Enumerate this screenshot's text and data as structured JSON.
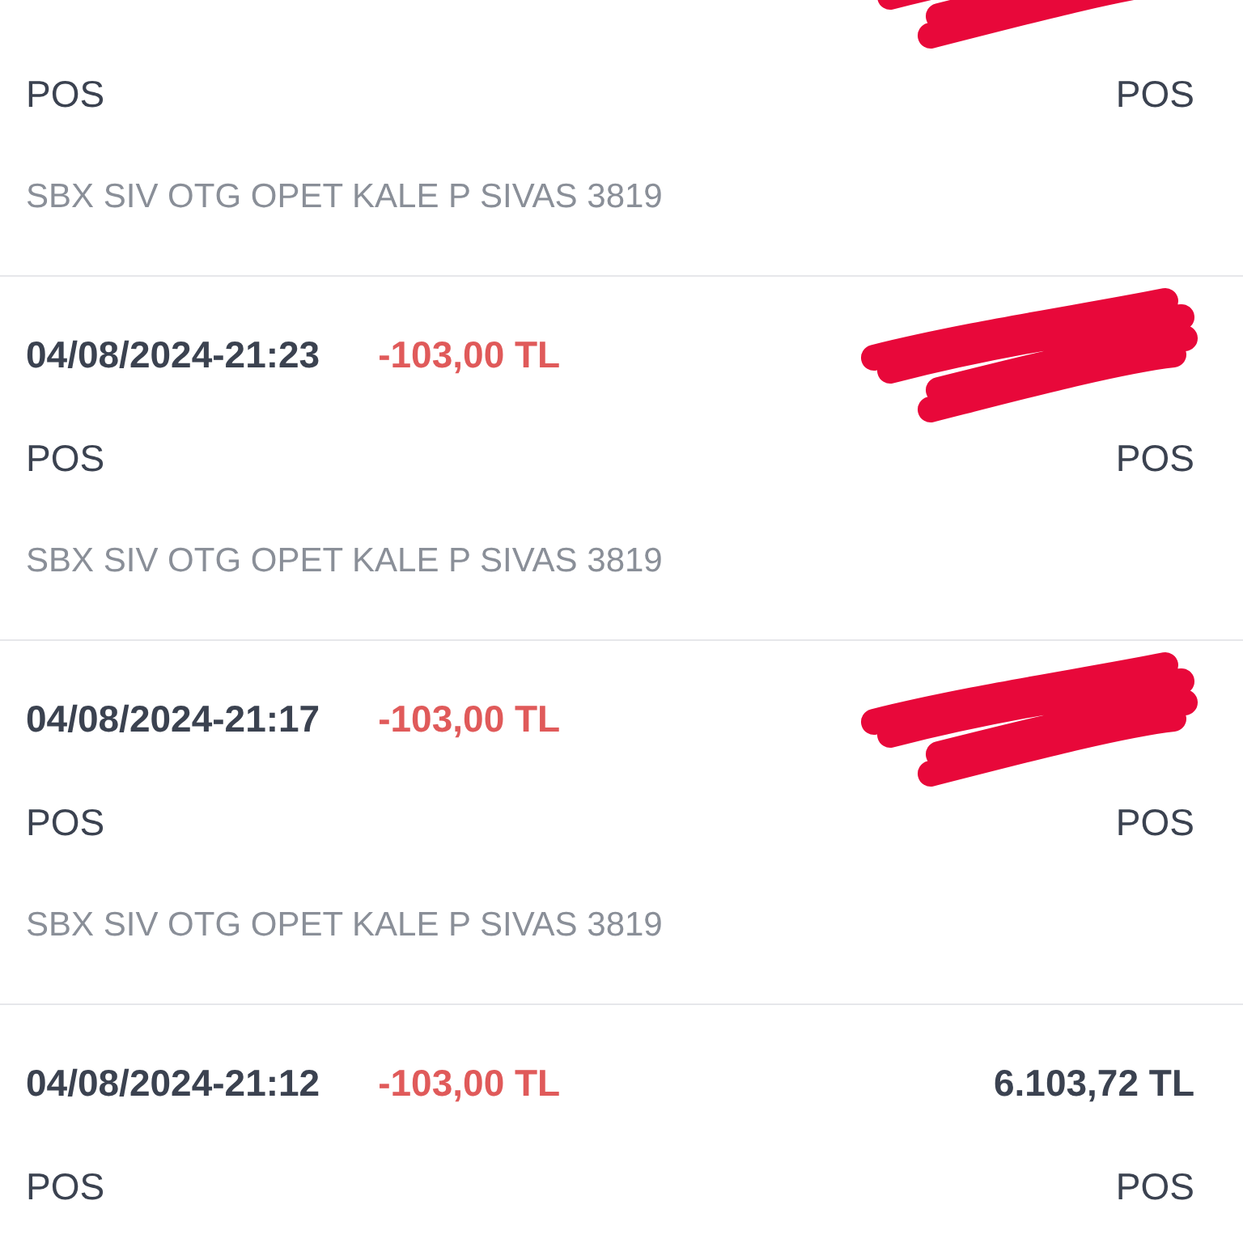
{
  "transactions": [
    {
      "redacted": true,
      "type_left": "POS",
      "type_right": "POS",
      "description": "SBX SIV OTG OPET KALE P SIVAS 3819"
    },
    {
      "datetime": "04/08/2024-21:23",
      "amount": "-103,00 TL",
      "redacted": true,
      "type_left": "POS",
      "type_right": "POS",
      "description": "SBX SIV OTG OPET KALE P SIVAS 3819"
    },
    {
      "datetime": "04/08/2024-21:17",
      "amount": "-103,00 TL",
      "redacted": true,
      "type_left": "POS",
      "type_right": "POS",
      "description": "SBX SIV OTG OPET KALE P SIVAS 3819"
    },
    {
      "datetime": "04/08/2024-21:12",
      "amount": "-103,00 TL",
      "balance": "6.103,72 TL",
      "redacted": false,
      "type_left": "POS",
      "type_right": "POS"
    }
  ]
}
